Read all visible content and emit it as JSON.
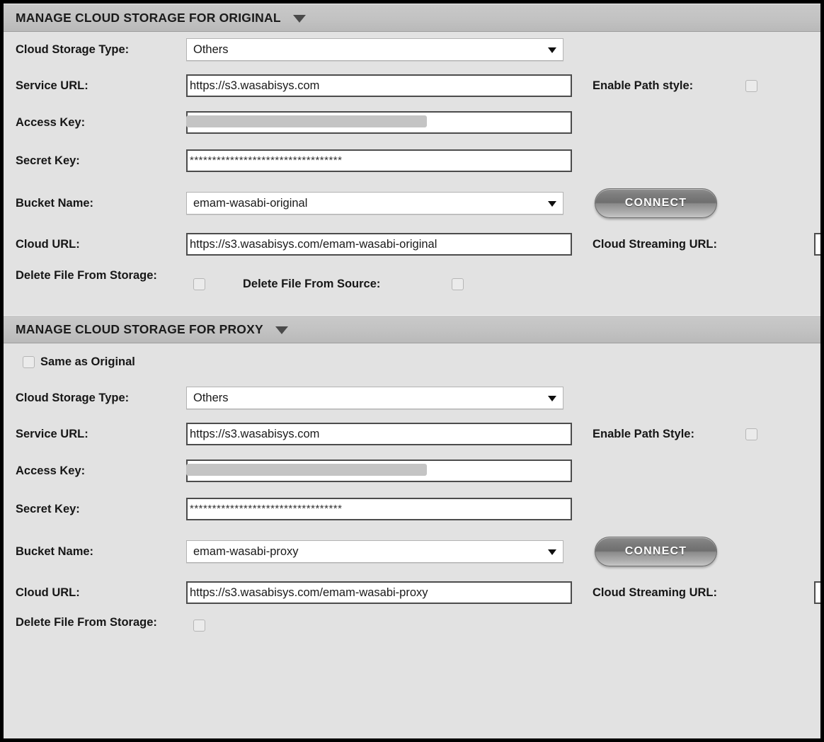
{
  "sections": [
    {
      "header": "MANAGE CLOUD STORAGE FOR ORIGINAL",
      "same_as_original_label": null,
      "fields": {
        "cloud_storage_type_label": "Cloud Storage Type:",
        "cloud_storage_type_value": "Others",
        "service_url_label": "Service URL:",
        "service_url_value": "https://s3.wasabisys.com",
        "enable_path_style_label": "Enable Path style:",
        "access_key_label": "Access Key:",
        "access_key_value": "",
        "secret_key_label": "Secret Key:",
        "secret_key_value": "**********************************",
        "bucket_name_label": "Bucket Name:",
        "bucket_name_value": "emam-wasabi-original",
        "connect_label": "CONNECT",
        "cloud_url_label": "Cloud URL:",
        "cloud_url_value": "https://s3.wasabisys.com/emam-wasabi-original",
        "cloud_streaming_url_label": "Cloud Streaming URL:",
        "cloud_streaming_url_value": "",
        "delete_file_from_storage_label": "Delete File From Storage:",
        "delete_file_from_source_label": "Delete File From Source:"
      }
    },
    {
      "header": "MANAGE CLOUD STORAGE FOR PROXY",
      "same_as_original_label": "Same as Original",
      "fields": {
        "cloud_storage_type_label": "Cloud Storage Type:",
        "cloud_storage_type_value": "Others",
        "service_url_label": "Service URL:",
        "service_url_value": "https://s3.wasabisys.com",
        "enable_path_style_label": "Enable Path Style:",
        "access_key_label": "Access Key:",
        "access_key_value": "",
        "secret_key_label": "Secret Key:",
        "secret_key_value": "**********************************",
        "bucket_name_label": "Bucket Name:",
        "bucket_name_value": "emam-wasabi-proxy",
        "connect_label": "CONNECT",
        "cloud_url_label": "Cloud URL:",
        "cloud_url_value": "https://s3.wasabisys.com/emam-wasabi-proxy",
        "cloud_streaming_url_label": "Cloud Streaming URL:",
        "cloud_streaming_url_value": "",
        "delete_file_from_storage_label": "Delete File From Storage:",
        "delete_file_from_source_label": null
      }
    }
  ],
  "icons": {
    "collapse": "chevron-down-icon",
    "dropdown": "chevron-down-icon"
  },
  "colors": {
    "header_bar": "#c2c2c2",
    "body_background": "#e2e2e2",
    "input_border": "#4c4c4c",
    "outer_border": "#000000",
    "redaction": "#c4c4c4"
  }
}
